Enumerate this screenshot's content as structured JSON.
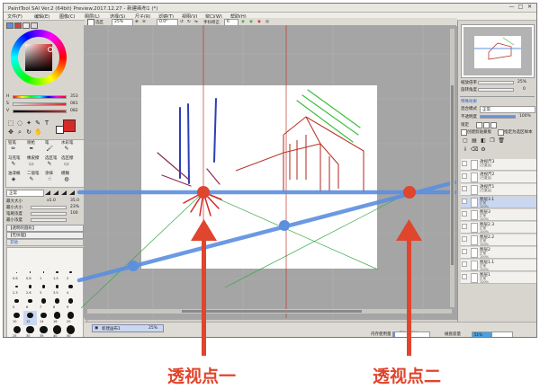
{
  "window": {
    "title": "PaintTool SAI Ver.2 (64bit) Preview.2017.12.27 - 新建画布1 (*)",
    "controls": [
      "—",
      "□",
      "✕"
    ]
  },
  "menu": [
    "文件(F)",
    "编辑(E)",
    "图像(C)",
    "图层(L)",
    "选择(S)",
    "尺子(R)",
    "滤镜(T)",
    "视图(V)",
    "窗口(W)",
    "帮助(H)"
  ],
  "toolbar": {
    "select_label": "选区",
    "zoom": "25%",
    "angle": "0.0°",
    "stabilizer_label": "手抖修正",
    "stabilizer_value": "6"
  },
  "left_panel": {
    "hsv": {
      "h_label": "H",
      "h_value": "353",
      "s_label": "S",
      "s_value": "081",
      "v_label": "V",
      "v_value": "082"
    },
    "tool_tabs": [
      "铅笔",
      "喷枪",
      "笔",
      "水彩笔"
    ],
    "tool_row2": [
      "马克笔",
      "橡皮擦",
      "选区笔",
      "选区擦"
    ],
    "tool_row3": [
      "油漆桶",
      "二值笔",
      "涂抹",
      "模糊"
    ],
    "blend_mode": "正常",
    "brush_size_label": "最大大小",
    "brush_size_mult": "x5.0",
    "brush_size_value": "35.0",
    "min_size_label": "最小大小",
    "min_size_value": "23%",
    "density_label": "笔刷浓度",
    "density_value": "100",
    "min_density_label": "最小浓度",
    "shape_label": "【透明的圆形】",
    "texture_label": "【无纹理】",
    "advanced_label": "其他",
    "brush_sizes": [
      "0.6",
      "0.8",
      "1",
      "1.5",
      "2",
      "2.3",
      "2.6",
      "3",
      "3.5",
      "4",
      "5",
      "6",
      "7",
      "8",
      "9",
      "10",
      "12",
      "14",
      "16",
      "20",
      "25",
      "30",
      "35",
      "40",
      "50",
      "60",
      "70",
      "80",
      "100",
      "120"
    ]
  },
  "right_panel": {
    "nav_zoom_label": "缩放倍率",
    "nav_zoom_value": "25%",
    "nav_angle_label": "旋转角度",
    "nav_angle_value": "0",
    "effects_label": "特殊效果",
    "blend_label": "混合模式",
    "blend_value": "正常",
    "opacity_label": "不透明度",
    "opacity_value": "100%",
    "lock_label": "锁定",
    "clip_label": "创建剪贴蒙版",
    "sample_label": "指定为选区样本",
    "layers": [
      {
        "name": "透视尺3",
        "mode": "(已激活)",
        "selected": false
      },
      {
        "name": "透视尺2",
        "mode": "(已激活)",
        "selected": false
      },
      {
        "name": "透视尺1",
        "mode": "(已激活)",
        "selected": false
      },
      {
        "name": "图层3.1",
        "mode": "正常",
        "opacity": "100%",
        "selected": true
      },
      {
        "name": "图层3",
        "mode": "正常",
        "opacity": "100%",
        "selected": false
      },
      {
        "name": "图层2.3",
        "mode": "正常",
        "opacity": "100%",
        "selected": false
      },
      {
        "name": "图层2.2",
        "mode": "正常",
        "opacity": "100%",
        "selected": false
      },
      {
        "name": "图层2",
        "mode": "正常",
        "opacity": "100%",
        "selected": false
      },
      {
        "name": "图层1.1",
        "mode": "正常",
        "opacity": "100%",
        "selected": false
      },
      {
        "name": "图层1",
        "mode": "正常",
        "opacity": "100%",
        "selected": false
      }
    ]
  },
  "status": {
    "tab_name": "新建画布1",
    "tab_zoom": "25%",
    "memory_label": "内存使用量",
    "memory_value": "3% (4%)",
    "disk_label": "磁盘容量",
    "disk_value": "51%"
  },
  "captions": {
    "vp1": "透视点一",
    "vp2": "透视点二"
  },
  "colors": {
    "primary": "#d42a2a",
    "annotation_red": "#e0452d",
    "horizon_blue": "#5b8fe0",
    "guide_green": "#3aa84a",
    "sketch_blue": "#2d3fb5",
    "sketch_green": "#3cbf3c",
    "sketch_red": "#b8382c",
    "sketch_purple": "#8a2a55"
  }
}
